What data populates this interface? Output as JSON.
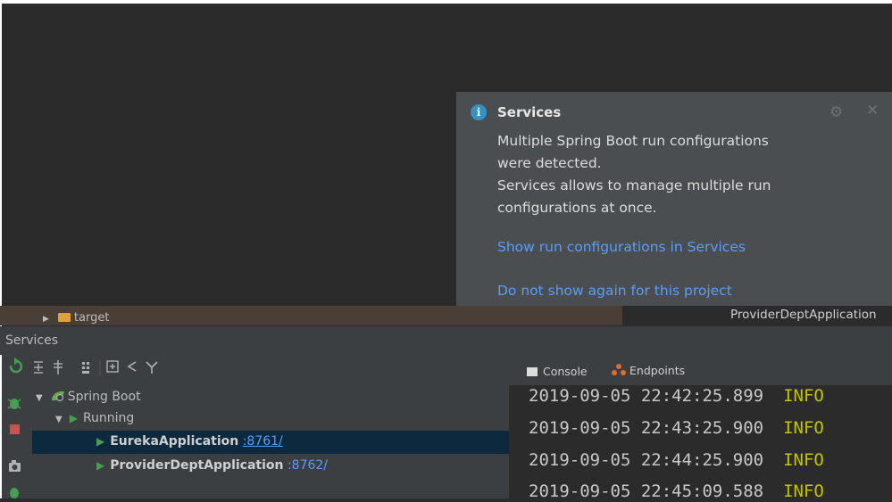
{
  "popup": {
    "title": "Services",
    "body_line1": "Multiple Spring Boot run configurations",
    "body_line2": "were detected.",
    "body_line3": "Services allows to manage multiple run",
    "body_line4": "configurations at once.",
    "link_show": "Show run configurations in Services",
    "link_dismiss": "Do not show again for this project",
    "info_icon": "i"
  },
  "project_tree": {
    "folder_label": "target",
    "arrow": "▶"
  },
  "editor_tab": {
    "label": "ProviderDeptApplication"
  },
  "services": {
    "title": "Services",
    "tree": {
      "root_label": "Spring Boot",
      "group_label": "Running",
      "items": [
        {
          "name": "EurekaApplication",
          "port": ":8761/"
        },
        {
          "name": "ProviderDeptApplication",
          "port": ":8762/"
        }
      ]
    },
    "tabs": {
      "console": "Console",
      "endpoints": "Endpoints"
    }
  },
  "console": {
    "lines": [
      {
        "timestamp": "2019-09-05 22:42:25.899",
        "level": "INFO"
      },
      {
        "timestamp": "2019-09-05 22:43:25.900",
        "level": "INFO"
      },
      {
        "timestamp": "2019-09-05 22:44:25.900",
        "level": "INFO"
      },
      {
        "timestamp": "2019-09-05 22:45:09.588",
        "level": "INFO"
      }
    ]
  },
  "colors": {
    "accent_link": "#589df6",
    "run_green": "#499c54",
    "info_blue": "#3592c4",
    "log_info": "#c4c400",
    "selection": "#0d293e"
  }
}
